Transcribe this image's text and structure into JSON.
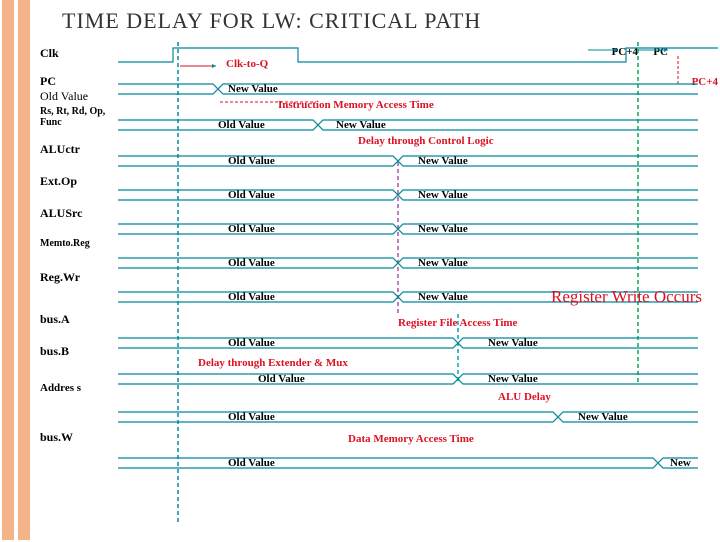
{
  "title": "TIME DELAY FOR LW: CRITICAL PATH",
  "topArrows": {
    "left": "PC+4",
    "right": "PC",
    "far": "PC+4"
  },
  "signals": [
    {
      "name": "Clk",
      "label": "Clk"
    },
    {
      "name": "PC",
      "label": "PC",
      "sub": "Old Value",
      "clkq": "Clk-to-Q",
      "new": "New Value"
    },
    {
      "name": "RsRtRd",
      "label": "Rs, Rt, Rd, Op, Func",
      "annot": "Instruction Memory Access Time",
      "old": "Old Value",
      "new": "New Value"
    },
    {
      "name": "ALUctr",
      "label": "ALUctr",
      "old": "Old Value",
      "new": "New Value",
      "annot": "Delay through Control Logic"
    },
    {
      "name": "ExtOp",
      "label": "Ext.Op",
      "old": "Old Value",
      "new": "New Value"
    },
    {
      "name": "ALUSrc",
      "label": "ALUSrc",
      "old": "Old Value",
      "new": "New Value"
    },
    {
      "name": "MemtoReg",
      "label": "Memto.Reg",
      "old": "Old Value",
      "new": "New Value"
    },
    {
      "name": "RegWr",
      "label": "Reg.Wr",
      "old": "Old Value",
      "new": "New Value"
    },
    {
      "name": "busA",
      "label": "bus.A",
      "old": "Old Value",
      "new": "New Value",
      "annot": "Register File Access Time"
    },
    {
      "name": "busB",
      "label": "bus.B",
      "old": "Old Value",
      "new": "New Value",
      "annot": "Delay through Extender & Mux"
    },
    {
      "name": "Address",
      "label": "Addres s",
      "old": "Old Value",
      "new": "New Value",
      "annot": "ALU Delay"
    },
    {
      "name": "busW",
      "label": "bus.W",
      "old": "Old Value",
      "new": "New",
      "annot": "Data Memory Access Time"
    }
  ],
  "regWrite": "Register Write Occurs"
}
